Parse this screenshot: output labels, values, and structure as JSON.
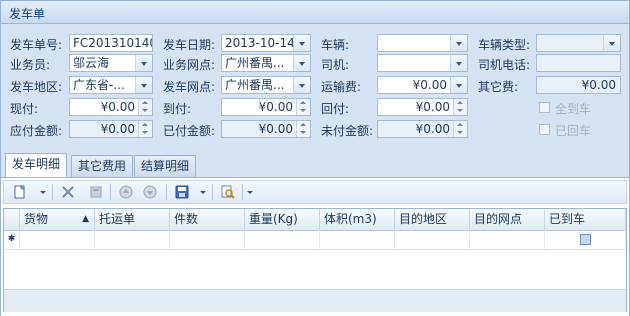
{
  "window": {
    "title": "发车单"
  },
  "form": {
    "bill_no": {
      "label": "发车单号:",
      "value": "FC201310140"
    },
    "date": {
      "label": "发车日期:",
      "value": "2013-10-14"
    },
    "vehicle": {
      "label": "车辆:",
      "value": ""
    },
    "vehicle_type": {
      "label": "车辆类型:",
      "value": ""
    },
    "salesman": {
      "label": "业务员:",
      "value": "邬云海"
    },
    "outlet": {
      "label": "业务网点:",
      "value": "广州番禺..."
    },
    "driver": {
      "label": "司机:",
      "value": ""
    },
    "driver_phone": {
      "label": "司机电话:",
      "value": ""
    },
    "region": {
      "label": "发车地区:",
      "value": "广东省-..."
    },
    "depart_outlet": {
      "label": "发车网点:",
      "value": "广州番禺..."
    },
    "freight": {
      "label": "运输费:",
      "value": "¥0.00"
    },
    "other_fee": {
      "label": "其它费:",
      "value": "¥0.00"
    },
    "cash_pay": {
      "label": "现付:",
      "value": "¥0.00"
    },
    "arrival_pay": {
      "label": "到付:",
      "value": "¥0.00"
    },
    "return_pay": {
      "label": "回付:",
      "value": "¥0.00"
    },
    "arrived_all": {
      "label": "全到车",
      "checked": false
    },
    "payable": {
      "label": "应付金额:",
      "value": "¥0.00"
    },
    "paid": {
      "label": "已付金额:",
      "value": "¥0.00"
    },
    "unpaid": {
      "label": "未付金额:",
      "value": "¥0.00"
    },
    "returned": {
      "label": "已回车",
      "checked": false
    }
  },
  "tabs": [
    {
      "label": "发车明细",
      "active": true
    },
    {
      "label": "其它费用",
      "active": false
    },
    {
      "label": "结算明细",
      "active": false
    }
  ],
  "toolbar": {
    "icons": [
      "new-icon",
      "delete-icon",
      "disabled-icon",
      "up-icon",
      "down-icon",
      "save-icon",
      "search-icon"
    ]
  },
  "grid": {
    "columns": [
      "货物",
      "托运单",
      "件数",
      "重量(Kg)",
      "体积(m3)",
      "目的地区",
      "目的网点",
      "已到车"
    ],
    "new_row_marker": "✱"
  },
  "colors": {
    "accent": "#15428b",
    "panel": "#d5e3f4",
    "border": "#9ab4d4"
  }
}
